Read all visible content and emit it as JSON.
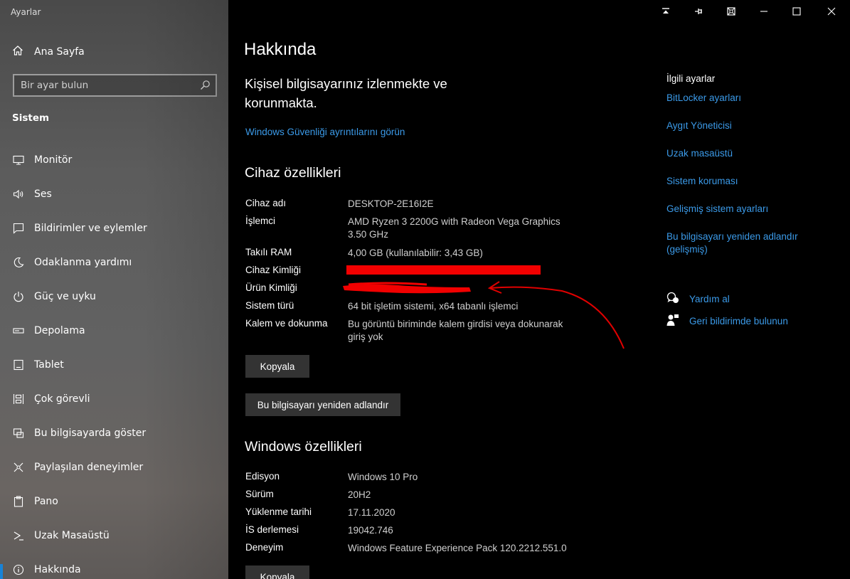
{
  "app": {
    "title": "Ayarlar"
  },
  "sidebar": {
    "home_label": "Ana Sayfa",
    "search_placeholder": "Bir ayar bulun",
    "section_label": "Sistem",
    "items": [
      {
        "label": "Monitör",
        "icon": "monitor-icon"
      },
      {
        "label": "Ses",
        "icon": "speaker-icon"
      },
      {
        "label": "Bildirimler ve eylemler",
        "icon": "notification-icon"
      },
      {
        "label": "Odaklanma yardımı",
        "icon": "moon-icon"
      },
      {
        "label": "Güç ve uyku",
        "icon": "power-icon"
      },
      {
        "label": "Depolama",
        "icon": "storage-icon"
      },
      {
        "label": "Tablet",
        "icon": "tablet-icon"
      },
      {
        "label": "Çok görevli",
        "icon": "multitask-icon"
      },
      {
        "label": "Bu bilgisayarda göster",
        "icon": "project-icon"
      },
      {
        "label": "Paylaşılan deneyimler",
        "icon": "shared-icon"
      },
      {
        "label": "Pano",
        "icon": "clipboard-icon"
      },
      {
        "label": "Uzak Masaüstü",
        "icon": "remote-desktop-icon"
      },
      {
        "label": "Hakkında",
        "icon": "info-icon"
      }
    ]
  },
  "main": {
    "title": "Hakkında",
    "protection_text": "Kişisel bilgisayarınız izlenmekte ve korunmakta.",
    "security_link": "Windows Güvenliği ayrıntılarını görün",
    "device_specs": {
      "heading": "Cihaz özellikleri",
      "rows": [
        {
          "key": "Cihaz adı",
          "value": "DESKTOP-2E16I2E"
        },
        {
          "key": "İşlemci",
          "value": "AMD Ryzen 3 2200G with Radeon Vega Graphics 3.50 GHz"
        },
        {
          "key": "Takılı RAM",
          "value": "4,00 GB (kullanılabilir: 3,43 GB)"
        },
        {
          "key": "Cihaz Kimliği",
          "value": ""
        },
        {
          "key": "Ürün Kimliği",
          "value": ""
        },
        {
          "key": "Sistem türü",
          "value": "64 bit işletim sistemi, x64 tabanlı işlemci"
        },
        {
          "key": "Kalem ve dokunma",
          "value": "Bu görüntü biriminde kalem girdisi veya dokunarak giriş yok"
        }
      ],
      "copy_button": "Kopyala",
      "rename_button": "Bu bilgisayarı yeniden adlandır"
    },
    "windows_specs": {
      "heading": "Windows özellikleri",
      "rows": [
        {
          "key": "Edisyon",
          "value": "Windows 10 Pro"
        },
        {
          "key": "Sürüm",
          "value": "20H2"
        },
        {
          "key": "Yüklenme tarihi",
          "value": "17.11.2020"
        },
        {
          "key": "İS derlemesi",
          "value": "19042.746"
        },
        {
          "key": "Deneyim",
          "value": "Windows Feature Experience Pack 120.2212.551.0"
        }
      ],
      "copy_button": "Kopyala"
    }
  },
  "related": {
    "heading": "İlgili ayarlar",
    "links": [
      "BitLocker ayarları",
      "Aygıt Yöneticisi",
      "Uzak masaüstü",
      "Sistem koruması",
      "Gelişmiş sistem ayarları",
      "Bu bilgisayarı yeniden adlandır (gelişmiş)"
    ],
    "help_label": "Yardım al",
    "feedback_label": "Geri bildirimde bulunun"
  },
  "colors": {
    "accent": "#1883d7",
    "link": "#3b9ae8",
    "redaction": "#f20000"
  }
}
